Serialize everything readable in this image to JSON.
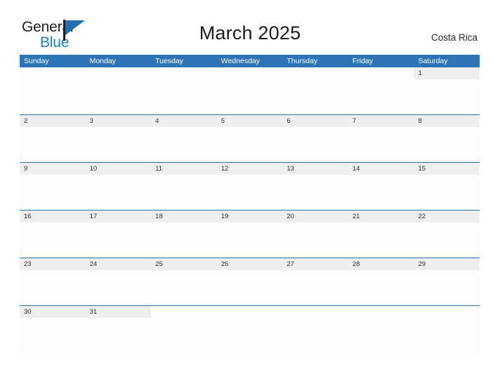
{
  "branding": {
    "word_one": "General",
    "word_two": "Blue",
    "flag_icon": "general-blue-flag-icon",
    "color_dark": "#231f20",
    "color_blue": "#1c7fc3"
  },
  "header": {
    "title": "March 2025",
    "region": "Costa Rica"
  },
  "calendar": {
    "accent_color": "#2e74b5",
    "date_band_color": "#efefef",
    "day_headers": [
      "Sunday",
      "Monday",
      "Tuesday",
      "Wednesday",
      "Thursday",
      "Friday",
      "Saturday"
    ],
    "weeks": [
      {
        "days": [
          {
            "date": "",
            "events": []
          },
          {
            "date": "",
            "events": []
          },
          {
            "date": "",
            "events": []
          },
          {
            "date": "",
            "events": []
          },
          {
            "date": "",
            "events": []
          },
          {
            "date": "",
            "events": []
          },
          {
            "date": "1",
            "events": []
          }
        ]
      },
      {
        "days": [
          {
            "date": "2",
            "events": []
          },
          {
            "date": "3",
            "events": []
          },
          {
            "date": "4",
            "events": []
          },
          {
            "date": "5",
            "events": []
          },
          {
            "date": "6",
            "events": []
          },
          {
            "date": "7",
            "events": []
          },
          {
            "date": "8",
            "events": []
          }
        ]
      },
      {
        "days": [
          {
            "date": "9",
            "events": []
          },
          {
            "date": "10",
            "events": []
          },
          {
            "date": "11",
            "events": []
          },
          {
            "date": "12",
            "events": []
          },
          {
            "date": "13",
            "events": []
          },
          {
            "date": "14",
            "events": []
          },
          {
            "date": "15",
            "events": []
          }
        ]
      },
      {
        "days": [
          {
            "date": "16",
            "events": []
          },
          {
            "date": "17",
            "events": []
          },
          {
            "date": "18",
            "events": []
          },
          {
            "date": "19",
            "events": []
          },
          {
            "date": "20",
            "events": []
          },
          {
            "date": "21",
            "events": []
          },
          {
            "date": "22",
            "events": []
          }
        ]
      },
      {
        "days": [
          {
            "date": "23",
            "events": []
          },
          {
            "date": "24",
            "events": []
          },
          {
            "date": "25",
            "events": []
          },
          {
            "date": "26",
            "events": []
          },
          {
            "date": "27",
            "events": []
          },
          {
            "date": "28",
            "events": []
          },
          {
            "date": "29",
            "events": []
          }
        ]
      },
      {
        "days": [
          {
            "date": "30",
            "events": []
          },
          {
            "date": "31",
            "events": []
          },
          {
            "date": "",
            "events": []
          },
          {
            "date": "",
            "events": []
          },
          {
            "date": "",
            "events": []
          },
          {
            "date": "",
            "events": []
          },
          {
            "date": "",
            "events": []
          }
        ]
      }
    ]
  }
}
